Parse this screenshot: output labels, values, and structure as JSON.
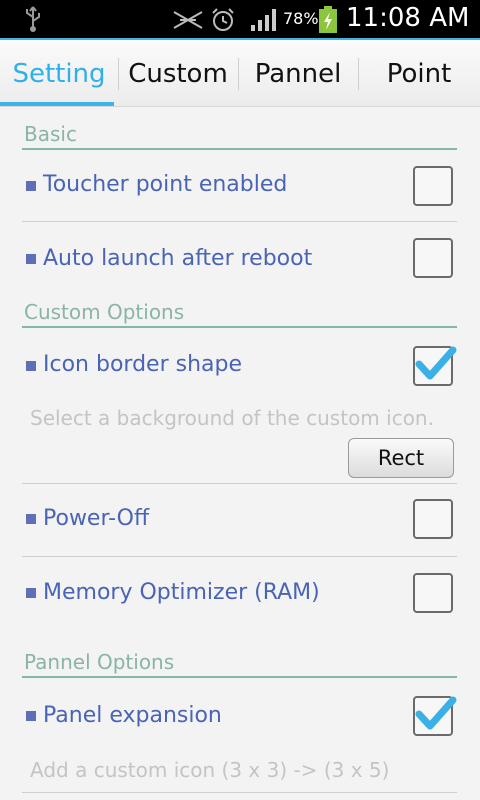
{
  "status_bar": {
    "battery_percent": "78%",
    "time": "11:08 AM",
    "icons": [
      "usb-icon",
      "mute-icon",
      "alarm-icon",
      "signal-icon",
      "battery-charging-icon"
    ]
  },
  "tabs": [
    {
      "label": "Setting",
      "active": true
    },
    {
      "label": "Custom",
      "active": false
    },
    {
      "label": "Pannel",
      "active": false
    },
    {
      "label": "Point",
      "active": false
    }
  ],
  "colors": {
    "accent": "#3cb4e8",
    "section_header": "#8ab4a6",
    "label": "#4a64b5",
    "check": "#3ab0e6"
  },
  "sections": {
    "basic": {
      "title": "Basic",
      "items": [
        {
          "label": "Toucher point enabled",
          "checked": false
        },
        {
          "label": "Auto launch after reboot",
          "checked": false
        }
      ]
    },
    "custom_options": {
      "title": "Custom Options",
      "icon_border": {
        "label": "Icon border shape",
        "checked": true,
        "summary": "Select a background of the custom icon.",
        "button_label": "Rect"
      },
      "items": [
        {
          "label": "Power-Off",
          "checked": false
        },
        {
          "label": "Memory Optimizer (RAM)",
          "checked": false
        }
      ]
    },
    "pannel_options": {
      "title": "Pannel Options",
      "panel_expansion": {
        "label": "Panel expansion",
        "checked": true,
        "summary": "Add a custom icon (3 x 3) -> (3 x 5)"
      }
    }
  }
}
